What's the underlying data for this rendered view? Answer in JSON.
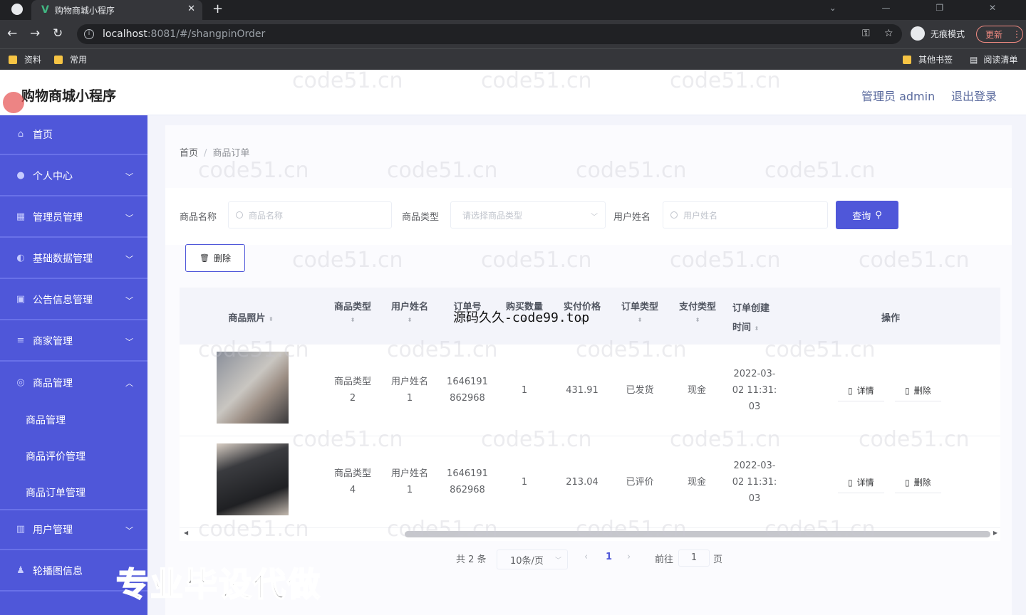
{
  "browser": {
    "tab_title": "购物商城小程序",
    "url_host": "localhost",
    "url_rest": ":8081/#/shangpinOrder",
    "incognito_label": "无痕模式",
    "update_label": "更新",
    "bookmarks": [
      "资料",
      "常用",
      "其他书签",
      "阅读清单"
    ]
  },
  "header": {
    "title": "购物商城小程序",
    "admin_label": "管理员 admin",
    "logout_label": "退出登录"
  },
  "sidebar": {
    "items": [
      {
        "label": "首页",
        "icon": "home-icon"
      },
      {
        "label": "个人中心",
        "icon": "user-icon"
      },
      {
        "label": "管理员管理",
        "icon": "admin-icon"
      },
      {
        "label": "基础数据管理",
        "icon": "data-icon"
      },
      {
        "label": "公告信息管理",
        "icon": "notice-icon"
      },
      {
        "label": "商家管理",
        "icon": "list-icon"
      },
      {
        "label": "商品管理",
        "icon": "goods-icon"
      },
      {
        "label": "用户管理",
        "icon": "users-icon"
      },
      {
        "label": "轮播图信息",
        "icon": "image-icon"
      }
    ],
    "sub_items": [
      "商品管理",
      "商品评价管理",
      "商品订单管理"
    ]
  },
  "breadcrumb": {
    "home": "首页",
    "current": "商品订单"
  },
  "search": {
    "name_label": "商品名称",
    "name_placeholder": "商品名称",
    "type_label": "商品类型",
    "type_placeholder": "请选择商品类型",
    "user_label": "用户姓名",
    "user_placeholder": "用户姓名",
    "query_label": "查询"
  },
  "toolbar": {
    "delete_label": "删除"
  },
  "table": {
    "headers": [
      "商品照片",
      "商品类型",
      "用户姓名",
      "订单号",
      "购买数量",
      "实付价格",
      "订单类型",
      "支付类型",
      "订单创建时间",
      "操作"
    ],
    "rows": [
      {
        "type": "商品类型2",
        "user": "用户姓名1",
        "order_no": "1646191862968",
        "qty": "1",
        "price": "431.91",
        "order_type": "已发货",
        "pay_type": "现金",
        "created": "2022-03-02 11:31:03"
      },
      {
        "type": "商品类型4",
        "user": "用户姓名1",
        "order_no": "1646191862968",
        "qty": "1",
        "price": "213.04",
        "order_type": "已评价",
        "pay_type": "现金",
        "created": "2022-03-02 11:31:03"
      }
    ],
    "detail_label": "详情",
    "row_delete_label": "删除"
  },
  "pagination": {
    "total": "共 2 条",
    "page_size": "10条/页",
    "current_page": "1",
    "goto_label": "前往",
    "goto_value": "1",
    "page_suffix": "页"
  },
  "overlays": {
    "watermark": "code51.cn",
    "source_text": "源码久久-code99.top",
    "promo_text": "专业毕设代做"
  }
}
